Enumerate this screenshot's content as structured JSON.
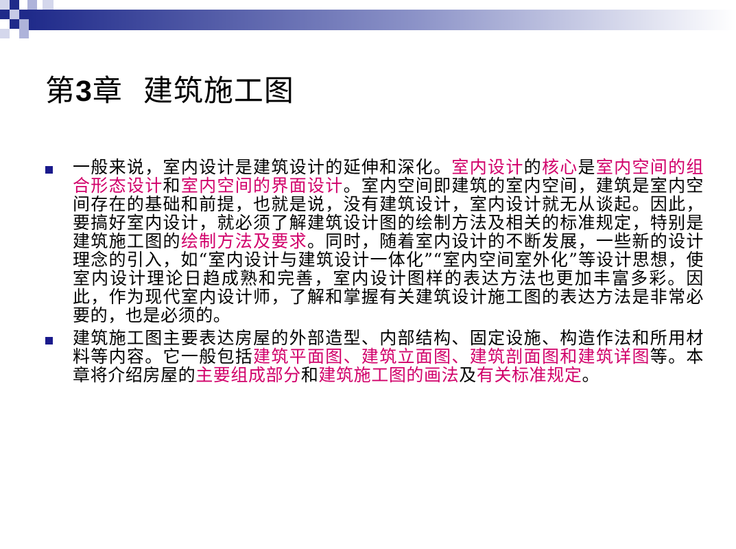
{
  "slide": {
    "title_prefix": "第",
    "title_number": "3",
    "title_suffix": "章",
    "title_text": "建筑施工图",
    "colors": {
      "bullet": "#1a1a8c",
      "highlight": "#d1006a",
      "decor_dark": "#1f2a8a"
    },
    "bullets": [
      {
        "segments": [
          {
            "t": "一般来说，室内设计是建筑设计的延伸和深化。",
            "hl": false
          },
          {
            "t": "室内设计",
            "hl": true
          },
          {
            "t": "的",
            "hl": false
          },
          {
            "t": "核心",
            "hl": true
          },
          {
            "t": "是",
            "hl": false
          },
          {
            "t": "室内空间的组合形态设计",
            "hl": true
          },
          {
            "t": "和",
            "hl": false
          },
          {
            "t": "室内空间的界面设计",
            "hl": true
          },
          {
            "t": "。室内空间即建筑的室内空间，建筑是室内空间存在的基础和前提，也就是说，没有建筑设计，室内设计就无从谈起。因此，要搞好室内设计，就必须了解建筑设计图的绘制方法及相关的标准规定，特别是建筑施工图的",
            "hl": false
          },
          {
            "t": "绘制方法及要求",
            "hl": true
          },
          {
            "t": "。同时，随着室内设计的不断发展，一些新的设计理念的引入，如“室内设计与建筑设计一体化”“室内空间室外化”等设计思想，使室内设计理论日趋成熟和完善，室内设计图样的表达方法也更加丰富多彩。因此，作为现代室内设计师，了解和掌握有关建筑设计施工图的表达方法是非常必要的，也是必须的。",
            "hl": false
          }
        ]
      },
      {
        "segments": [
          {
            "t": "建筑施工图主要表达房屋的外部造型、内部结构、固定设施、构造作法和所用材料等内容。它一般包括",
            "hl": false
          },
          {
            "t": "建筑平面图、建筑立面图、建筑剖面图和建筑详图",
            "hl": true
          },
          {
            "t": "等。本章将介绍房屋的",
            "hl": false
          },
          {
            "t": "主要组成部分",
            "hl": true
          },
          {
            "t": "和",
            "hl": false
          },
          {
            "t": "建筑施工图的画法",
            "hl": true
          },
          {
            "t": "及",
            "hl": false
          },
          {
            "t": "有关标准规定",
            "hl": true
          },
          {
            "t": "。",
            "hl": false
          }
        ]
      }
    ]
  }
}
